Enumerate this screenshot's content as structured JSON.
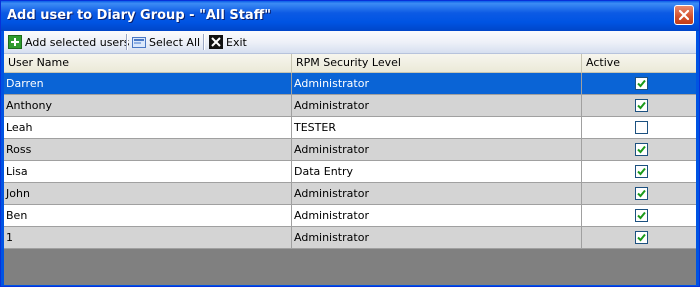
{
  "window": {
    "title": "Add user to Diary Group - \"All Staff\""
  },
  "toolbar": {
    "add_label": "Add selected users",
    "select_all_label": "Select All",
    "exit_label": "Exit"
  },
  "grid": {
    "columns": [
      "User Name",
      "RPM Security Level",
      "Active"
    ],
    "rows": [
      {
        "name": "Darren",
        "level": "Administrator",
        "active": true,
        "selected": true
      },
      {
        "name": "Anthony",
        "level": "Administrator",
        "active": true
      },
      {
        "name": "Leah",
        "level": "TESTER",
        "active": false
      },
      {
        "name": "Ross",
        "level": "Administrator",
        "active": true
      },
      {
        "name": "Lisa",
        "level": "Data Entry",
        "active": true
      },
      {
        "name": "John",
        "level": "Administrator",
        "active": true
      },
      {
        "name": "Ben",
        "level": "Administrator",
        "active": true
      },
      {
        "name": "1",
        "level": "Administrator",
        "active": true
      }
    ]
  },
  "colors": {
    "selected_row": "#0a64d6",
    "alt_row": "#d4d4d4",
    "empty_area": "#808080",
    "check": "#1a9a1a"
  },
  "icons": {
    "add": "add-plus-icon",
    "select_all": "select-all-icon",
    "exit": "exit-x-icon",
    "close": "close-icon"
  }
}
